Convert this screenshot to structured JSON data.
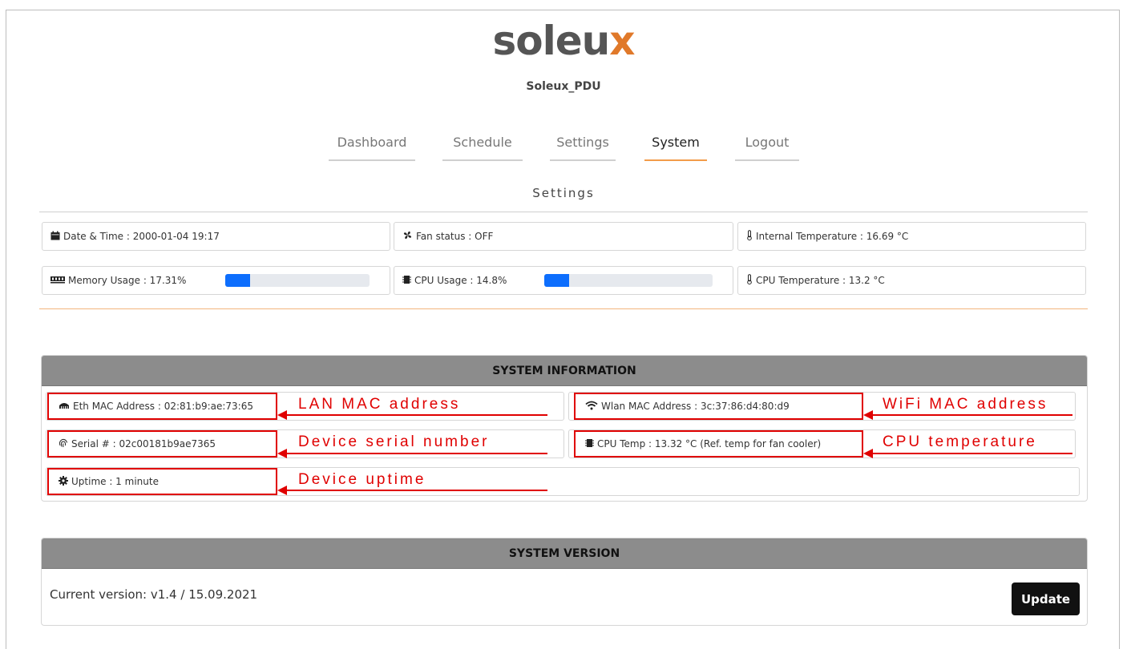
{
  "header": {
    "logo_text": "soleu",
    "logo_accent": "x",
    "device_name": "Soleux_PDU"
  },
  "nav": {
    "items": [
      {
        "label": "Dashboard"
      },
      {
        "label": "Schedule"
      },
      {
        "label": "Settings"
      },
      {
        "label": "System"
      },
      {
        "label": "Logout"
      }
    ],
    "active": "System"
  },
  "settings": {
    "title": "Settings",
    "date_time": "Date & Time : 2000-01-04 19:17",
    "fan_status": "Fan status : OFF",
    "internal_temp": "Internal Temperature : 16.69 °C",
    "memory_usage": "Memory Usage : 17.31%",
    "memory_usage_pct": 17.31,
    "cpu_usage": "CPU Usage : 14.8%",
    "cpu_usage_pct": 14.8,
    "cpu_temp": "CPU Temperature : 13.2 °C"
  },
  "system_info": {
    "title": "SYSTEM INFORMATION",
    "eth_mac": "Eth MAC Address : 02:81:b9:ae:73:65",
    "wlan_mac": "Wlan MAC Address : 3c:37:86:d4:80:d9",
    "serial": "Serial # : 02c00181b9ae7365",
    "cpu_temp": "CPU Temp : 13.32 °C (Ref. temp for fan cooler)",
    "uptime": "Uptime : 1 minute"
  },
  "annotations": {
    "lan_mac": "LAN MAC address",
    "wifi_mac": "WiFi MAC address",
    "serial": "Device serial number",
    "cpu_temp": "CPU temperature",
    "uptime": "Device uptime"
  },
  "system_version": {
    "title": "SYSTEM VERSION",
    "current": "Current version: v1.4 / 15.09.2021",
    "update_label": "Update"
  },
  "colors": {
    "accent": "#f39c4a",
    "progress": "#0d6efd",
    "annotation": "#e00000",
    "panel_header": "#8c8c8c"
  },
  "icons": {
    "date_time": "calendar-icon",
    "fan": "fan-icon",
    "thermometer": "thermometer-icon",
    "memory": "memory-icon",
    "cpu": "cpu-icon",
    "ethernet": "ethernet-icon",
    "wifi": "wifi-icon",
    "serial": "fingerprint-icon",
    "uptime": "gear-icon"
  }
}
